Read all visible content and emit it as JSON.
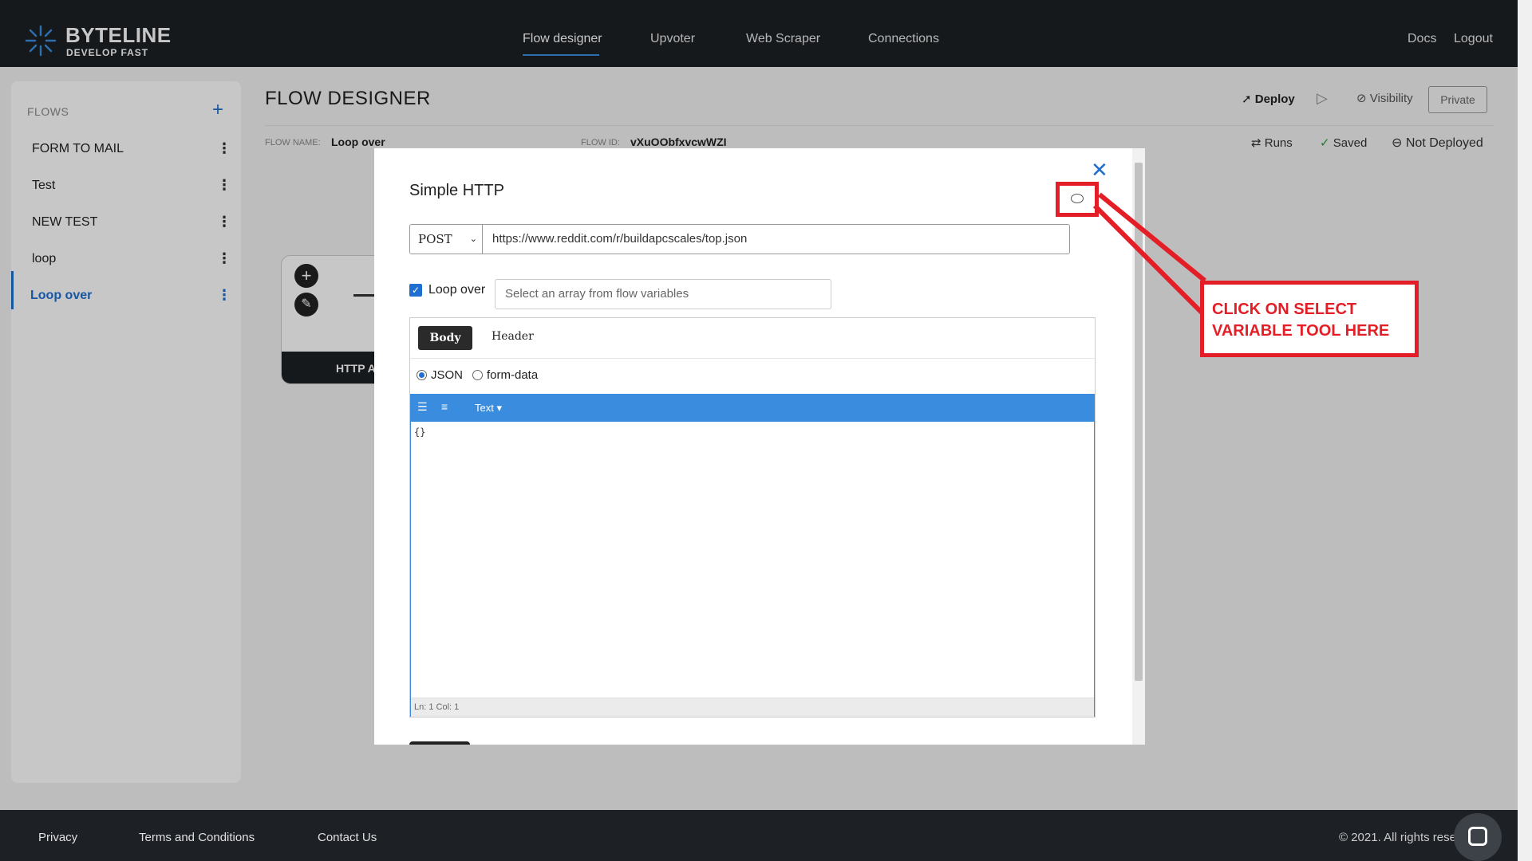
{
  "brand": {
    "name": "BYTELINE",
    "tagline": "DEVELOP FAST"
  },
  "nav": {
    "links": [
      "Flow designer",
      "Upvoter",
      "Web Scraper",
      "Connections"
    ],
    "right": [
      "Docs",
      "Logout"
    ]
  },
  "sidebar": {
    "heading": "FLOWS",
    "add_label": "+",
    "items": [
      "FORM TO MAIL",
      "Test",
      "NEW TEST",
      "loop",
      "Loop over"
    ],
    "menu_glyph": "⋮"
  },
  "header": {
    "title": "FLOW DESIGNER",
    "deploy_label": "Deploy",
    "visibility_label": "Visibility",
    "private_label": "Private",
    "flow_name_label": "FLOW NAME:",
    "flow_name_value": "Loop over",
    "flow_id_label": "FLOW ID:",
    "flow_id_value": "vXuOObfxvcwWZI",
    "runs_label": "Runs",
    "saved_label": "Saved",
    "deploy_status": "Not Deployed"
  },
  "canvas": {
    "node_label": "HTTP A"
  },
  "modal": {
    "title": "Simple HTTP",
    "close_glyph": "✕",
    "method": "POST",
    "url": "https://www.reddit.com/r/buildapcscales/top.json",
    "loop_over_label": "Loop over",
    "loop_over_checked": true,
    "loop_placeholder": "Select an array from flow variables",
    "tabs": [
      "Body",
      "Header"
    ],
    "body_types": [
      "JSON",
      "form-data"
    ],
    "selected_body_type": "JSON",
    "editor_mode": "Text ▾",
    "editor_content": "{}",
    "editor_status": "Ln: 1     Col: 1"
  },
  "annotation": {
    "lines": [
      "CLICK ON SELECT",
      "VARIABLE TOOL HERE"
    ],
    "color": "#e41e26"
  },
  "footer": {
    "links": [
      "Privacy",
      "Terms and Conditions",
      "Contact Us"
    ],
    "copyright": "© 2021. All rights rese"
  },
  "colors": {
    "accent": "#1f6fd0",
    "nav_bg": "#1d2024",
    "editor_bar": "#3a8dde"
  }
}
